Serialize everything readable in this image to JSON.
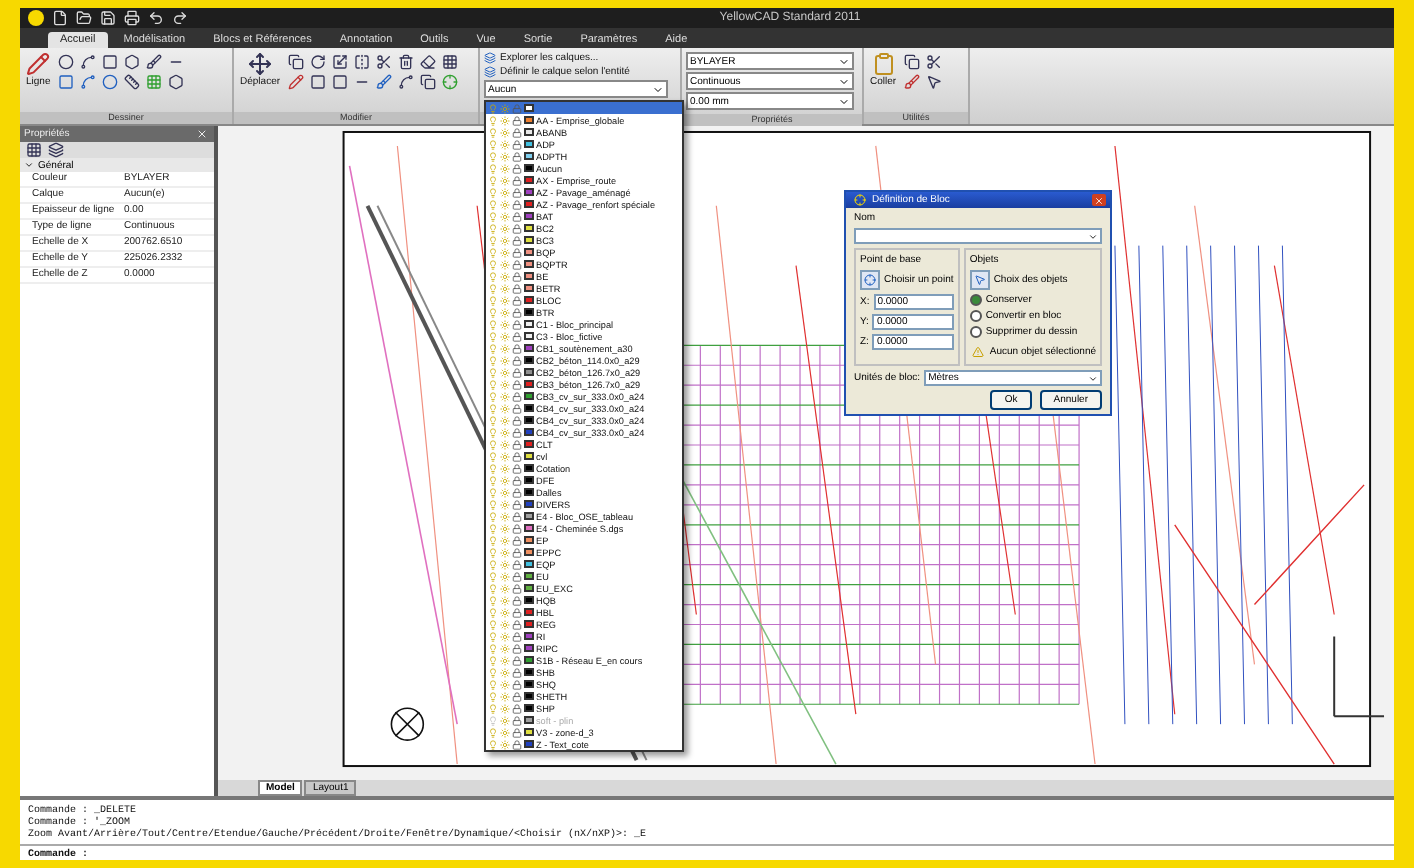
{
  "window": {
    "title": "YellowCAD Standard 2011"
  },
  "tabs": [
    {
      "label": "Accueil",
      "selected": true
    },
    {
      "label": "Modélisation",
      "selected": false
    },
    {
      "label": "Blocs et Références",
      "selected": false
    },
    {
      "label": "Annotation",
      "selected": false
    },
    {
      "label": "Outils",
      "selected": false
    },
    {
      "label": "Vue",
      "selected": false
    },
    {
      "label": "Sortie",
      "selected": false
    },
    {
      "label": "Paramètres",
      "selected": false
    },
    {
      "label": "Aide",
      "selected": false
    }
  ],
  "ribbon": {
    "draw": {
      "label": "Dessiner",
      "big_button": "Ligne"
    },
    "modify": {
      "label": "Modifier",
      "big_button": "Déplacer"
    },
    "layers": {
      "commands": [
        "Explorer les calques...",
        "Définir le calque selon l'entité"
      ],
      "current": "Aucun"
    },
    "properties": {
      "label": "Propriétés",
      "combos": [
        "BYLAYER",
        "Continuous",
        "0.00 mm"
      ]
    },
    "clipboard": {
      "label": "Utilités",
      "big_button": "Coller"
    }
  },
  "properties_panel": {
    "title": "Propriétés",
    "section": "Général",
    "expanded": true,
    "rows": [
      {
        "label": "Couleur",
        "value": "BYLAYER"
      },
      {
        "label": "Calque",
        "value": "Aucun(e)"
      },
      {
        "label": "Epaisseur de ligne",
        "value": "0.00"
      },
      {
        "label": "Type de ligne",
        "value": "Continuous"
      },
      {
        "label": "Echelle de X",
        "value": "200762.6510"
      },
      {
        "label": "Echelle de Y",
        "value": "225026.2332"
      },
      {
        "label": "Echelle de Z",
        "value": "0.0000"
      }
    ]
  },
  "layer_list": {
    "items": [
      {
        "selected": true,
        "on": true,
        "color": "#ffffff"
      },
      {
        "name": "AA - Emprise_globale",
        "selected": false,
        "on": true,
        "color": "#f08030"
      },
      {
        "name": "ABANB",
        "selected": false,
        "on": true,
        "color": "#e8e8e8"
      },
      {
        "name": "ADP",
        "selected": false,
        "on": true,
        "color": "#40c0e0"
      },
      {
        "name": "ADPTH",
        "selected": false,
        "on": true,
        "color": "#80d0f0"
      },
      {
        "name": "Aucun",
        "selected": false,
        "on": true,
        "color": "#000000"
      },
      {
        "name": "AX - Emprise_route",
        "selected": false,
        "on": true,
        "color": "#e02020"
      },
      {
        "name": "AZ - Pavage_aménagé",
        "selected": false,
        "on": true,
        "color": "#a040c0"
      },
      {
        "name": "AZ - Pavage_renfort spéciale",
        "selected": false,
        "on": true,
        "color": "#e02020"
      },
      {
        "name": "BAT",
        "selected": false,
        "on": true,
        "color": "#a040c0"
      },
      {
        "name": "BC2",
        "selected": false,
        "on": true,
        "color": "#e0e040"
      },
      {
        "name": "BC3",
        "selected": false,
        "on": true,
        "color": "#e0e040"
      },
      {
        "name": "BQP",
        "selected": false,
        "on": true,
        "color": "#f09080"
      },
      {
        "name": "BQPTR",
        "selected": false,
        "on": true,
        "color": "#f09080"
      },
      {
        "name": "BE",
        "selected": false,
        "on": true,
        "color": "#f09080"
      },
      {
        "name": "BETR",
        "selected": false,
        "on": true,
        "color": "#f09080"
      },
      {
        "name": "BLOC",
        "selected": false,
        "on": true,
        "color": "#e02020"
      },
      {
        "name": "BTR",
        "selected": false,
        "on": true,
        "color": "#000000"
      },
      {
        "name": "C1 - Bloc_principal",
        "selected": false,
        "on": true,
        "color": "#f0f0f0"
      },
      {
        "name": "C3 - Bloc_fictive",
        "selected": false,
        "on": true,
        "color": "#f0f0f0"
      },
      {
        "name": "CB1_soutènement_a30",
        "selected": false,
        "on": true,
        "color": "#a040c0"
      },
      {
        "name": "CB2_béton_114.0x0_a29",
        "selected": false,
        "on": true,
        "color": "#000000"
      },
      {
        "name": "CB2_béton_126.7x0_a29",
        "selected": false,
        "on": true,
        "color": "#909090"
      },
      {
        "name": "CB3_béton_126.7x0_a29",
        "selected": false,
        "on": true,
        "color": "#e02020"
      },
      {
        "name": "CB3_cv_sur_333.0x0_a24",
        "selected": false,
        "on": true,
        "color": "#30a030"
      },
      {
        "name": "CB4_cv_sur_333.0x0_a24",
        "selected": false,
        "on": true,
        "color": "#000000"
      },
      {
        "name": "CB4_cv_sur_333.0x0_a24",
        "selected": false,
        "on": true,
        "color": "#000000"
      },
      {
        "name": "CB4_cv_sur_333.0x0_a24",
        "selected": false,
        "on": true,
        "color": "#2040c0"
      },
      {
        "name": "CLT",
        "selected": false,
        "on": true,
        "color": "#e02020"
      },
      {
        "name": "cvl",
        "selected": false,
        "on": true,
        "color": "#e0e040"
      },
      {
        "name": "Cotation",
        "selected": false,
        "on": true,
        "color": "#000000"
      },
      {
        "name": "DFE",
        "selected": false,
        "on": true,
        "color": "#000000"
      },
      {
        "name": "Dalles",
        "selected": false,
        "on": true,
        "color": "#000000"
      },
      {
        "name": "DIVERS",
        "selected": false,
        "on": true,
        "color": "#2040c0"
      },
      {
        "name": "E4 - Bloc_OSE_tableau",
        "selected": false,
        "on": true,
        "color": "#a0a0a0"
      },
      {
        "name": "E4 - Cheminée S.dgs",
        "selected": false,
        "on": true,
        "color": "#e070c0"
      },
      {
        "name": "EP",
        "selected": false,
        "on": true,
        "color": "#f09060"
      },
      {
        "name": "EPPC",
        "selected": false,
        "on": true,
        "color": "#f09060"
      },
      {
        "name": "EQP",
        "selected": false,
        "on": true,
        "color": "#40c0e0"
      },
      {
        "name": "EU",
        "selected": false,
        "on": true,
        "color": "#60b040"
      },
      {
        "name": "EU_EXC",
        "selected": false,
        "on": true,
        "color": "#60b040"
      },
      {
        "name": "HQB",
        "selected": false,
        "on": true,
        "color": "#000000"
      },
      {
        "name": "HBL",
        "selected": false,
        "on": true,
        "color": "#e02020"
      },
      {
        "name": "REG",
        "selected": false,
        "on": true,
        "color": "#e02020"
      },
      {
        "name": "RI",
        "selected": false,
        "on": true,
        "color": "#a040c0"
      },
      {
        "name": "RIPC",
        "selected": false,
        "on": true,
        "color": "#a040c0"
      },
      {
        "name": "S1B - Réseau E_en cours",
        "selected": false,
        "on": true,
        "color": "#30a030"
      },
      {
        "name": "SHB",
        "selected": false,
        "on": true,
        "color": "#000000"
      },
      {
        "name": "SHQ",
        "selected": false,
        "on": true,
        "color": "#000000"
      },
      {
        "name": "SHETH",
        "selected": false,
        "on": true,
        "color": "#000000"
      },
      {
        "name": "SHP",
        "selected": false,
        "on": true,
        "color": "#000000"
      },
      {
        "name": "soft - plin",
        "selected": false,
        "on": false,
        "color": "#a0a0a0"
      },
      {
        "name": "V3 - zone-d_3",
        "selected": false,
        "on": true,
        "color": "#e0e040"
      },
      {
        "name": "Z - Text_cote",
        "selected": false,
        "on": true,
        "color": "#2040c0"
      }
    ]
  },
  "dialog": {
    "title": "Définition de Bloc",
    "name_label": "Nom",
    "base_point": {
      "title": "Point de base",
      "pick": "Choisir un point",
      "fields": [
        {
          "label": "X:",
          "value": "0.0000"
        },
        {
          "label": "Y:",
          "value": "0.0000"
        },
        {
          "label": "Z:",
          "value": "0.0000"
        }
      ]
    },
    "objects": {
      "title": "Objets",
      "pick": "Choix des objets",
      "options": [
        {
          "label": "Conserver",
          "selected": true
        },
        {
          "label": "Convertir en bloc",
          "selected": false
        },
        {
          "label": "Supprimer du dessin",
          "selected": false
        }
      ],
      "warning": "Aucun objet sélectionné"
    },
    "units_label": "Unités de bloc:",
    "units_value": "Mètres",
    "buttons": [
      "Ok",
      "Annuler"
    ]
  },
  "layout_tabs": [
    {
      "label": "Model",
      "selected": true
    },
    {
      "label": "Layout1",
      "selected": false
    }
  ],
  "command": {
    "lines": [
      "Commande : _DELETE",
      "Commande : '_ZOOM",
      "Zoom  Avant/Arrière/Tout/Centre/Etendue/Gauche/Précédent/Droite/Fenêtre/Dynamique/<Choisir (nX/nXP)>: _E"
    ],
    "prompt": "Commande :"
  }
}
